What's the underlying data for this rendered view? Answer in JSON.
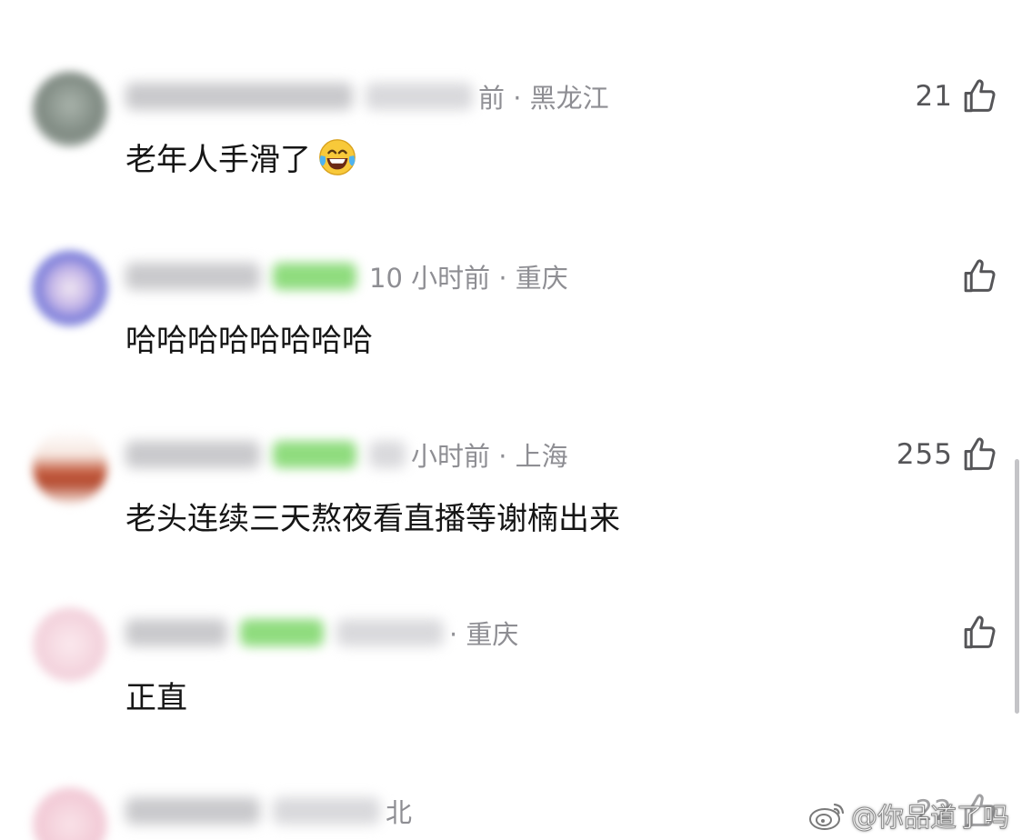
{
  "comments": [
    {
      "meta_visible": "前 · 黑龙江",
      "text": "老年人手滑了",
      "emoji": "laughing-tears-emoji",
      "likes": "21",
      "has_badge": false
    },
    {
      "meta_visible": "10 小时前 · 重庆",
      "text": "哈哈哈哈哈哈哈哈",
      "likes": "",
      "has_badge": true
    },
    {
      "meta_visible": "小时前 · 上海",
      "text": "老头连续三天熬夜看直播等谢楠出来",
      "likes": "255",
      "has_badge": true
    },
    {
      "meta_visible": "· 重庆",
      "text": "正直",
      "likes": "",
      "has_badge": true
    },
    {
      "meta_visible": "北",
      "text": "",
      "likes": "22",
      "has_badge": false
    }
  ],
  "watermark": {
    "text": "@你品道了吗",
    "icon": "weibo-logo-icon"
  },
  "colors": {
    "meta_gray": "#8e8e93",
    "text": "#161616",
    "badge_green": "#8fdc7e"
  }
}
